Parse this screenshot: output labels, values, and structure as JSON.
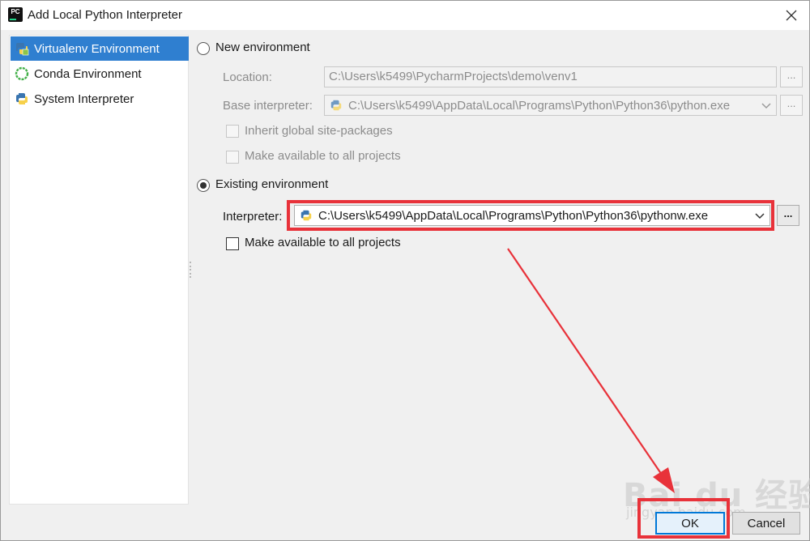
{
  "window": {
    "title": "Add Local Python Interpreter",
    "app_icon_text": "PC"
  },
  "sidebar": {
    "items": [
      {
        "label": "Virtualenv Environment",
        "icon": "virtualenv-icon",
        "selected": true
      },
      {
        "label": "Conda Environment",
        "icon": "conda-icon",
        "selected": false
      },
      {
        "label": "System Interpreter",
        "icon": "python-icon",
        "selected": false
      }
    ]
  },
  "new_env": {
    "radio_label": "New environment",
    "selected": false,
    "location_label": "Location:",
    "location_value": "C:\\Users\\k5499\\PycharmProjects\\demo\\venv1",
    "base_label": "Base interpreter:",
    "base_value": "C:\\Users\\k5499\\AppData\\Local\\Programs\\Python\\Python36\\python.exe",
    "inherit_label": "Inherit global site-packages",
    "make_available_label": "Make available to all projects"
  },
  "existing_env": {
    "radio_label": "Existing environment",
    "selected": true,
    "interpreter_label": "Interpreter:",
    "interpreter_value": "C:\\Users\\k5499\\AppData\\Local\\Programs\\Python\\Python36\\pythonw.exe",
    "make_available_label": "Make available to all projects",
    "make_available_checked": false
  },
  "browse_label": "...",
  "buttons": {
    "ok": "OK",
    "cancel": "Cancel"
  },
  "watermark": {
    "main": "Bai du 经验",
    "sub": "jingyan.baidu.com"
  },
  "colors": {
    "selection": "#2f7fd0",
    "annotation": "#e8323a",
    "ok_border": "#0078d7"
  }
}
